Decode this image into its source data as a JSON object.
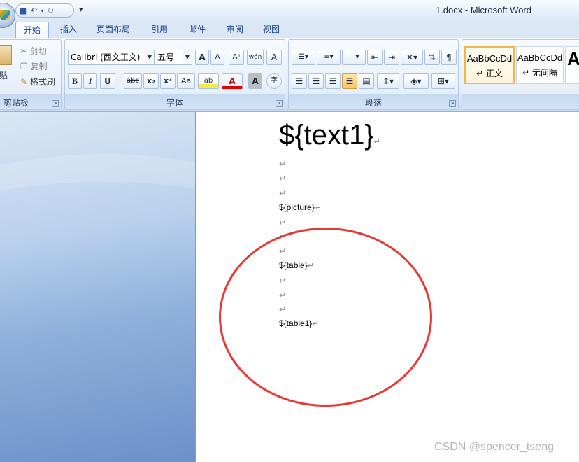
{
  "window": {
    "title": "1.docx - Microsoft Word"
  },
  "qat": {
    "more": "▾"
  },
  "tabs": [
    {
      "label": "开始"
    },
    {
      "label": "插入"
    },
    {
      "label": "页面布局"
    },
    {
      "label": "引用"
    },
    {
      "label": "邮件"
    },
    {
      "label": "审阅"
    },
    {
      "label": "视图"
    }
  ],
  "clipboard": {
    "paste": "贴",
    "cut": "剪切",
    "copy": "复制",
    "format_painter": "格式刷",
    "group_label": "剪贴板"
  },
  "font": {
    "name": "Calibri (西文正文)",
    "size": "五号",
    "grow": "A",
    "shrink": "A",
    "clear": "Aᵃ",
    "phonetic": "wén",
    "border_char": "A",
    "bold": "B",
    "italic": "I",
    "underline": "U",
    "strike": "abc",
    "subscript": "x₂",
    "superscript": "x²",
    "case": "Aa",
    "highlight": "ab",
    "color": "A",
    "shade": "A",
    "enclose": "字",
    "group_label": "字体"
  },
  "paragraph": {
    "group_label": "段落"
  },
  "styles": [
    {
      "preview": "AaBbCcDd",
      "name": "↵ 正文",
      "selected": true
    },
    {
      "preview": "AaBbCcDd",
      "name": "↵ 无间隔",
      "selected": false
    },
    {
      "preview": "A",
      "name": "",
      "selected": false
    }
  ],
  "document": {
    "title": "${text1}",
    "mark": "↵",
    "picture": "${picture}",
    "table": "${table}",
    "table1": "${table1}"
  },
  "watermark": "CSDN @spencer_tseng",
  "colors": {
    "annotation": "#e53935",
    "accent": "#15428b"
  }
}
